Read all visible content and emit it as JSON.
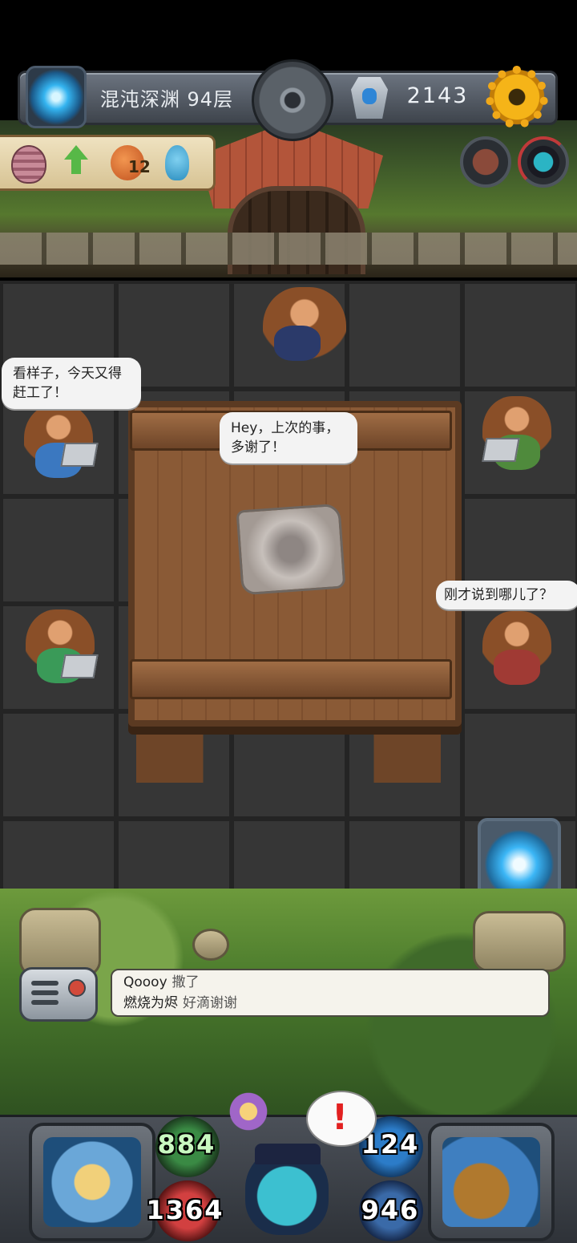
{
  "header": {
    "floor_title": "混沌深渊 94层",
    "gem_count": "2143",
    "icons": [
      "portal-icon",
      "compass-disc-icon",
      "blue-gem-icon",
      "gear-icon"
    ]
  },
  "items_panel": {
    "fox_count": "12",
    "icons": [
      "mummy-egg-icon",
      "green-up-arrow-icon",
      "fox-icon",
      "blue-spirit-icon"
    ]
  },
  "top_right_icons": [
    "brain-icon",
    "ninja-avatar-icon"
  ],
  "dialogue": {
    "left_bubble": "看样子，今天又得赶工了！",
    "center_bubble": "Hey，上次的事，多谢了！",
    "right_bubble": "刚才说到哪儿了？"
  },
  "chat": {
    "lines": [
      {
        "name": "Qoooy",
        "message": "撒了"
      },
      {
        "name": "燃烧为烬",
        "message": "好滴谢谢"
      }
    ]
  },
  "stats": {
    "attack": "884",
    "hp": "1364",
    "defense": "124",
    "mp": "946"
  },
  "alert": {
    "mark": "!"
  },
  "colors": {
    "gold": "#f5b418",
    "panel_parchment": "#efe2c0",
    "alert_red": "#e22020"
  }
}
